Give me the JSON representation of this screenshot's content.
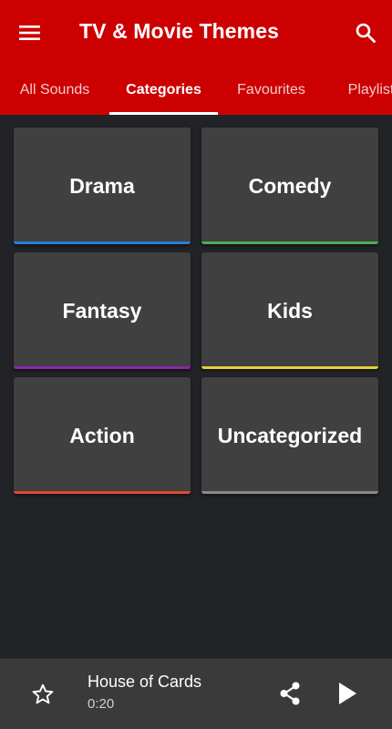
{
  "app": {
    "title": "TV & Movie Themes",
    "brand_color": "#cc0000",
    "background_color": "#222326"
  },
  "toolbar": {
    "menu_icon": "hamburger-menu-icon",
    "search_icon": "search-icon"
  },
  "tabs": [
    {
      "label": "All Sounds",
      "active": false
    },
    {
      "label": "Categories",
      "active": true
    },
    {
      "label": "Favourites",
      "active": false
    },
    {
      "label": "Playlists",
      "active": false
    }
  ],
  "categories": [
    {
      "label": "Drama",
      "color": "#2a7fd4"
    },
    {
      "label": "Comedy",
      "color": "#4caf50"
    },
    {
      "label": "Fantasy",
      "color": "#8e24aa"
    },
    {
      "label": "Kids",
      "color": "#e6d13a"
    },
    {
      "label": "Action",
      "color": "#d84a33"
    },
    {
      "label": "Uncategorized",
      "color": "#8a8a8a"
    }
  ],
  "player": {
    "track_title": "House of Cards",
    "track_time": "0:20",
    "favourite_icon": "star-outline-icon",
    "share_icon": "share-icon",
    "play_icon": "play-icon"
  }
}
